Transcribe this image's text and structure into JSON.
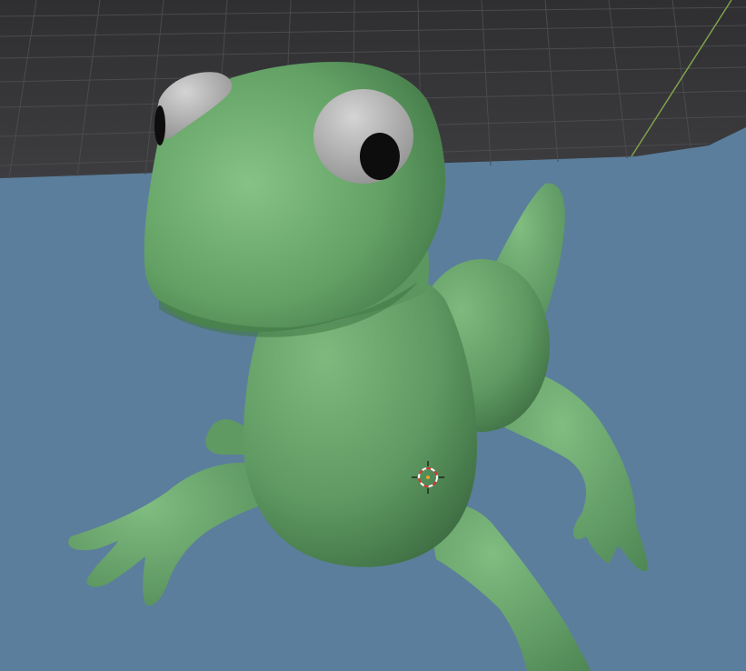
{
  "app": "3D viewport",
  "viewport": {
    "background_color": "#5b7e9c",
    "grid_floor_color": "#3a3a3c",
    "grid_line_color": "#4a4a4c",
    "axis_line_color": "#7fa24a",
    "model_color": "#6aa36b",
    "model_shadow_color": "#3f7444",
    "eye_white_color": "#bdbdbd",
    "pupil_color": "#0d0d0d",
    "cursor_colors": [
      "#e03030",
      "#ffffff"
    ]
  },
  "objects": [
    {
      "name": "dinosaur-mesh",
      "icon": "mesh-object"
    },
    {
      "name": "3d-cursor",
      "icon": "crosshair-icon"
    }
  ]
}
